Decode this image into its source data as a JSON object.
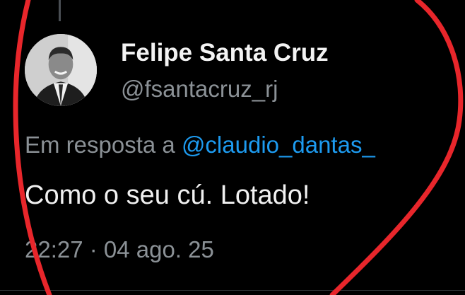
{
  "tweet": {
    "author": {
      "display_name": "Felipe Santa Cruz",
      "handle": "@fsantacruz_rj"
    },
    "reply_prefix": "Em resposta a",
    "reply_to": "@claudio_dantas_",
    "text": "Como o seu cú. Lotado!",
    "timestamp": "22:27 · 04 ago. 25"
  },
  "colors": {
    "background": "#000000",
    "text": "#e7e9ea",
    "secondary": "#8b9196",
    "link": "#1d9bf0",
    "annotation": "#e8262b"
  }
}
